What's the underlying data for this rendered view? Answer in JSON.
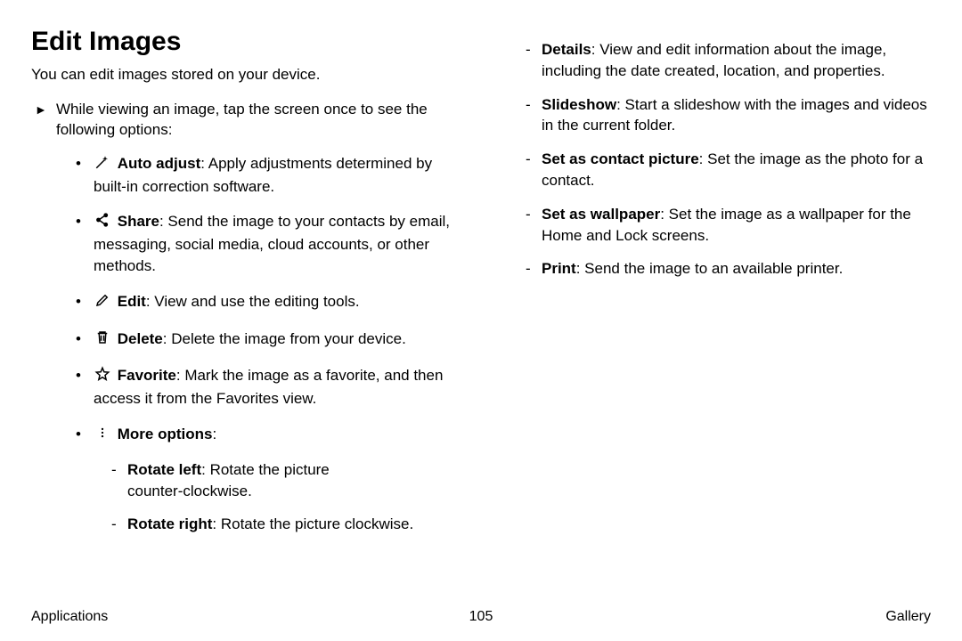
{
  "heading": "Edit Images",
  "intro": "You can edit images stored on your device.",
  "step_marker": "►",
  "step_text": "While viewing an image, tap the screen once to see the following options:",
  "options": {
    "auto_adjust": {
      "label": "Auto adjust",
      "desc": ": Apply adjustments determined by built‑in correction software."
    },
    "share": {
      "label": "Share",
      "desc": ": Send the image to your contacts by email, messaging, social media, cloud accounts, or other methods."
    },
    "edit": {
      "label": "Edit",
      "desc": ": View and use the editing tools."
    },
    "delete": {
      "label": "Delete",
      "desc": ": Delete the image from your device."
    },
    "favorite": {
      "label": "Favorite",
      "desc": ": Mark the image as a favorite, and then access it from the Favorites view."
    },
    "more": {
      "label": "More options",
      "desc": ":"
    }
  },
  "more_sub_left": {
    "rotate_left": {
      "label": "Rotate left",
      "desc": ": Rotate the picture counter‑clockwise."
    },
    "rotate_right": {
      "label": "Rotate right",
      "desc": ": Rotate the picture clockwise."
    }
  },
  "more_sub_right": {
    "details": {
      "label": "Details",
      "desc": ": View and edit information about the image, including the date created, location, and properties."
    },
    "slideshow": {
      "label": "Slideshow",
      "desc": ": Start a slideshow with the images and videos in the current folder."
    },
    "contact": {
      "label": "Set as contact picture",
      "desc": ": Set the image as the photo for a contact."
    },
    "wallpaper": {
      "label": "Set as wallpaper",
      "desc": ": Set the image as a wallpaper for the Home and Lock screens."
    },
    "print": {
      "label": "Print",
      "desc": ": Send the image to an available printer."
    }
  },
  "footer": {
    "left": "Applications",
    "center": "105",
    "right": "Gallery"
  }
}
